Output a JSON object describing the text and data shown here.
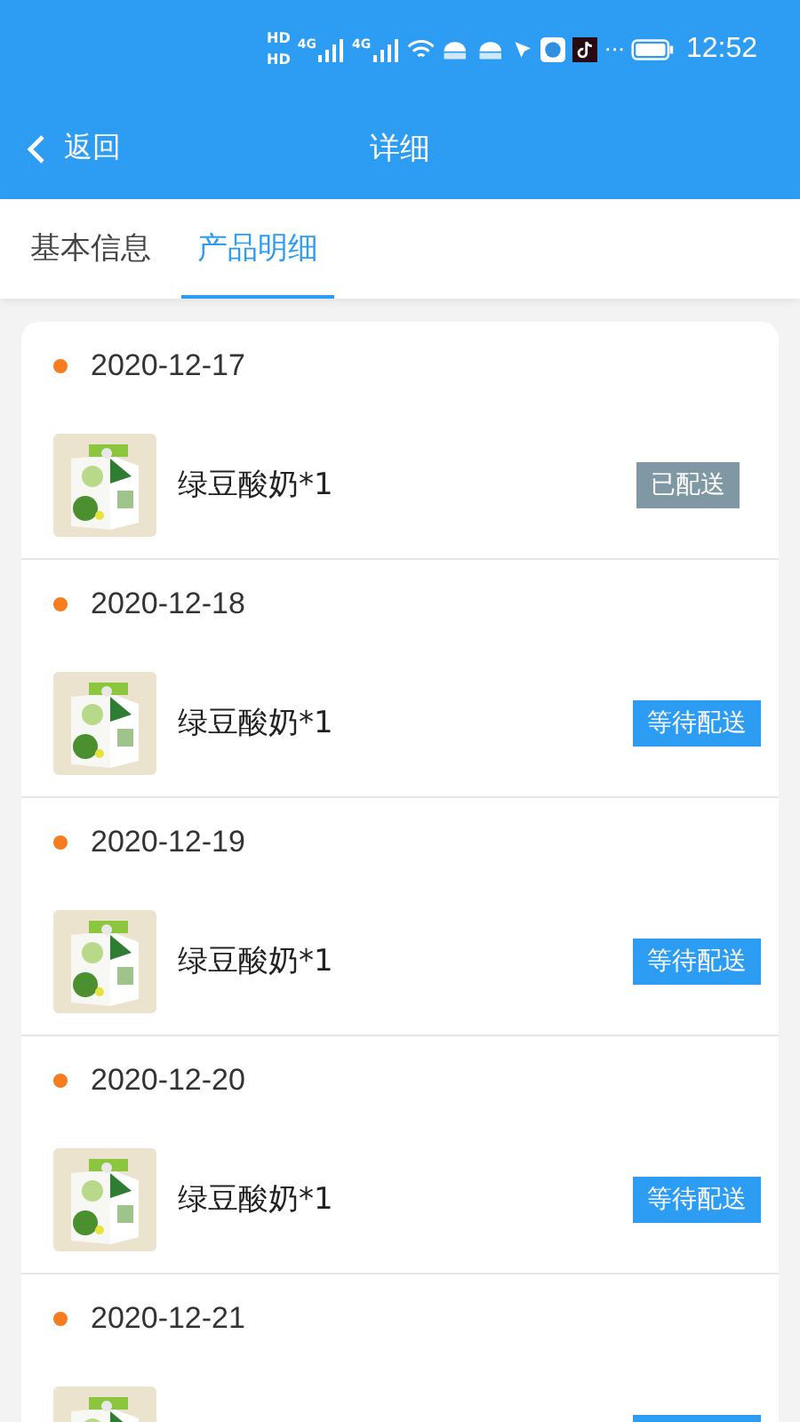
{
  "status_bar": {
    "time": "12:52",
    "hd_labels": [
      "HD",
      "HD"
    ],
    "signal_labels": [
      "4G",
      "4G"
    ],
    "more": "···"
  },
  "header": {
    "back_label": "返回",
    "title": "详细"
  },
  "tabs": [
    {
      "label": "基本信息",
      "selected": false
    },
    {
      "label": "产品明细",
      "selected": true
    }
  ],
  "orders": [
    {
      "date": "2020-12-17",
      "product": {
        "name": "绿豆酸奶*1",
        "kind": "picture"
      },
      "status": {
        "kind": "delivered",
        "label": "已配送"
      }
    },
    {
      "date": "2020-12-18",
      "product": {
        "name": "绿豆酸奶*1",
        "kind": "picture"
      },
      "status": {
        "kind": "pending",
        "label": "等待配送"
      }
    },
    {
      "date": "2020-12-19",
      "product": {
        "name": "绿豆酸奶*1",
        "kind": "picture"
      },
      "status": {
        "kind": "pending",
        "label": "等待配送"
      }
    },
    {
      "date": "2020-12-20",
      "product": {
        "name": "绿豆酸奶*1",
        "kind": "picture"
      },
      "status": {
        "kind": "pending",
        "label": "等待配送"
      }
    },
    {
      "date": "2020-12-21",
      "status": {
        "kind": "pending"
      }
    }
  ]
}
